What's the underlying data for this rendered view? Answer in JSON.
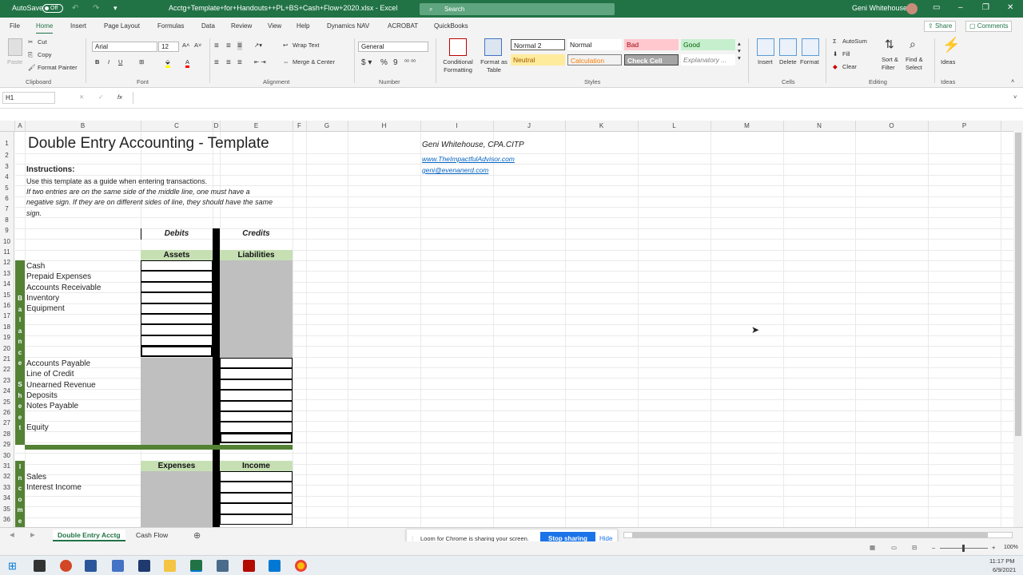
{
  "titlebar": {
    "autosave": "AutoSave",
    "autosave_state": "Off",
    "filename": "Acctg+Template+for+Handouts++PL+BS+Cash+Flow+2020.xlsx - Excel",
    "search": "Search",
    "user": "Geni Whitehouse"
  },
  "menu": {
    "tabs": [
      "File",
      "Home",
      "Insert",
      "Page Layout",
      "Formulas",
      "Data",
      "Review",
      "View",
      "Help",
      "Dynamics NAV",
      "ACROBAT",
      "QuickBooks"
    ],
    "active": "Home",
    "share": "Share",
    "comments": "Comments"
  },
  "ribbon": {
    "clipboard": {
      "paste": "Paste",
      "cut": "Cut",
      "copy": "Copy",
      "format_painter": "Format Painter",
      "group": "Clipboard"
    },
    "font": {
      "name": "Arial",
      "size": "12",
      "group": "Font"
    },
    "alignment": {
      "wrap": "Wrap Text",
      "merge": "Merge & Center",
      "group": "Alignment"
    },
    "number": {
      "format": "General",
      "group": "Number"
    },
    "styles": {
      "conditional": "Conditional Formatting",
      "format_table": "Format as Table",
      "cells": [
        "Normal 2",
        "Normal",
        "Bad",
        "Good",
        "Neutral",
        "Calculation",
        "Check Cell",
        "Explanatory ..."
      ],
      "group": "Styles"
    },
    "cells": {
      "insert": "Insert",
      "delete": "Delete",
      "format": "Format",
      "group": "Cells"
    },
    "editing": {
      "autosum": "AutoSum",
      "fill": "Fill",
      "clear": "Clear",
      "sort": "Sort & Filter",
      "find": "Find & Select",
      "group": "Editing"
    },
    "ideas": {
      "label": "Ideas",
      "group": "Ideas"
    }
  },
  "namebox": "H1",
  "columns": [
    "A",
    "B",
    "C",
    "D",
    "E",
    "F",
    "G",
    "H",
    "I",
    "J",
    "K",
    "L",
    "M",
    "N",
    "O",
    "P"
  ],
  "rows": [
    "1",
    "2",
    "3",
    "4",
    "5",
    "6",
    "7",
    "8",
    "9",
    "10",
    "11",
    "12",
    "13",
    "14",
    "15",
    "16",
    "17",
    "18",
    "19",
    "20",
    "21",
    "22",
    "23",
    "24",
    "25",
    "26",
    "27",
    "28",
    "29",
    "30",
    "31",
    "32",
    "33",
    "34",
    "35",
    "36"
  ],
  "sheet": {
    "title": "Double Entry Accounting - Template",
    "author": "Geni Whitehouse, CPA.CITP",
    "website": "www.TheImpactfulAdvisor.com",
    "email": "geni@evenanerd.com",
    "instructions_label": "Instructions:",
    "instr1": "Use this template as a guide when entering transactions.",
    "instr2": "If two entries are on the same side of the middle line, one must have a",
    "instr3": "negative sign. If they are on different sides of line, they should have the same",
    "instr4": "sign.",
    "debits": "Debits",
    "credits": "Credits",
    "assets": "Assets",
    "liabilities": "Liabilities",
    "asset_items": [
      "Cash",
      "Prepaid Expenses",
      "Accounts Receivable",
      "Inventory",
      "Equipment"
    ],
    "liability_items": [
      "Accounts Payable",
      "Line of Credit",
      "Unearned Revenue",
      "Deposits",
      "Notes Payable"
    ],
    "equity": "Equity",
    "balance_sheet_vertical": [
      "B",
      "a",
      "l",
      "a",
      "n",
      "c",
      "e",
      "",
      "S",
      "h",
      "e",
      "e",
      "t"
    ],
    "expenses": "Expenses",
    "income": "Income",
    "income_items": [
      "Sales",
      "Interest Income"
    ],
    "income_vertical": [
      "I",
      "n",
      "c",
      "o",
      "m",
      "e"
    ]
  },
  "sheet_tabs": [
    "Double Entry Acctg",
    "Cash Flow"
  ],
  "toast": {
    "text": "Loom for Chrome is sharing your screen.",
    "stop": "Stop sharing",
    "hide": "Hide"
  },
  "status": {
    "zoom": "100%"
  },
  "clock": {
    "time": "11:17 PM",
    "date": "6/9/2021"
  }
}
